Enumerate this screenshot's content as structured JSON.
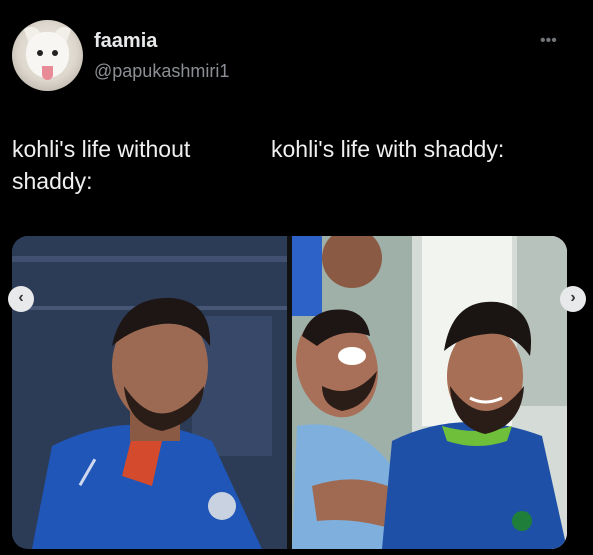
{
  "post": {
    "display_name": "faamia",
    "handle": "@papukashmiri1",
    "more_icon": "more-horizontal-icon",
    "caption_left": "kohli's life without shaddy:",
    "caption_right": "kohli's life with shaddy:"
  },
  "media": {
    "left_image": "kohli-sad-photo",
    "right_image": "kohli-laughing-with-shaddy-photo",
    "prev_icon": "chevron-left-icon",
    "next_icon": "chevron-right-icon"
  }
}
